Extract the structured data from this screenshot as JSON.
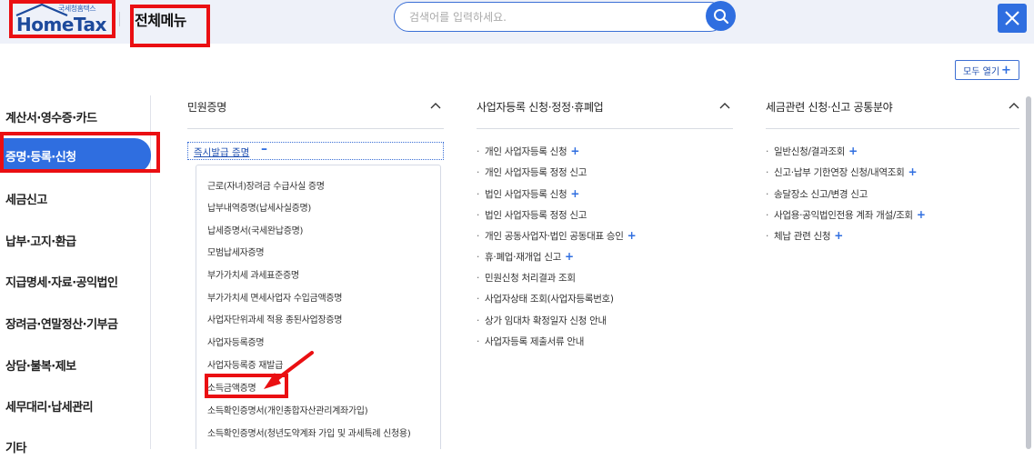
{
  "header": {
    "logo_sub": "국세청홈택스",
    "logo_main": "HomeTax",
    "title": "전체메뉴",
    "search_placeholder": "검색어를 입력하세요.",
    "expand_all": "모두 열기"
  },
  "sidebar": {
    "items": [
      "계산서·영수증·카드",
      "증명·등록·신청",
      "세금신고",
      "납부·고지·환급",
      "지급명세·자료·공익법인",
      "장려금·연말정산·기부금",
      "상담·불복·제보",
      "세무대리·납세관리",
      "기타"
    ],
    "active_index": 1
  },
  "columns": [
    {
      "title": "민원증명",
      "instant_label": "즉시발급 증명",
      "instant_items": [
        "근로(자녀)장려금 수급사실 증명",
        "납부내역증명(납세사실증명)",
        "납세증명서(국세완납증명)",
        "모범납세자증명",
        "부가가치세 과세표준증명",
        "부가가치세 면세사업자 수입금액증명",
        "사업자단위과세 적용 종된사업장증명",
        "사업자등록증명",
        "사업자등록증 재발급",
        "소득금액증명",
        "소득확인증명서(개인종합자산관리계좌가입)",
        "소득확인증명서(청년도약계좌 가입 및 과세특례 신청용)"
      ]
    },
    {
      "title": "사업자등록 신청·정정·휴폐업",
      "items": [
        {
          "label": "개인 사업자등록 신청",
          "plus": true
        },
        {
          "label": "개인 사업자등록 정정 신고",
          "plus": false
        },
        {
          "label": "법인 사업자등록 신청",
          "plus": true
        },
        {
          "label": "법인 사업자등록 정정 신고",
          "plus": false
        },
        {
          "label": "개인 공동사업자·법인 공동대표 승인",
          "plus": true
        },
        {
          "label": "휴·폐업·재개업 신고",
          "plus": true
        },
        {
          "label": "민원신청 처리결과 조회",
          "plus": false
        },
        {
          "label": "사업자상태 조회(사업자등록번호)",
          "plus": false
        },
        {
          "label": "상가 임대차 확정일자 신청 안내",
          "plus": false
        },
        {
          "label": "사업자등록 제출서류 안내",
          "plus": false
        }
      ]
    },
    {
      "title": "세금관련 신청·신고 공통분야",
      "items": [
        {
          "label": "일반신청/결과조회",
          "plus": true
        },
        {
          "label": "신고·납부 기한연장 신청/내역조회",
          "plus": true
        },
        {
          "label": "송달장소 신고/변경 신고",
          "plus": false
        },
        {
          "label": "사업용·공익법인전용 계좌 개설/조회",
          "plus": true
        },
        {
          "label": "체납 관련 신청",
          "plus": true
        }
      ]
    }
  ],
  "colors": {
    "accent": "#2f6ee0",
    "header_bg": "#eef1f9",
    "annotation_red": "#ea0f12"
  }
}
